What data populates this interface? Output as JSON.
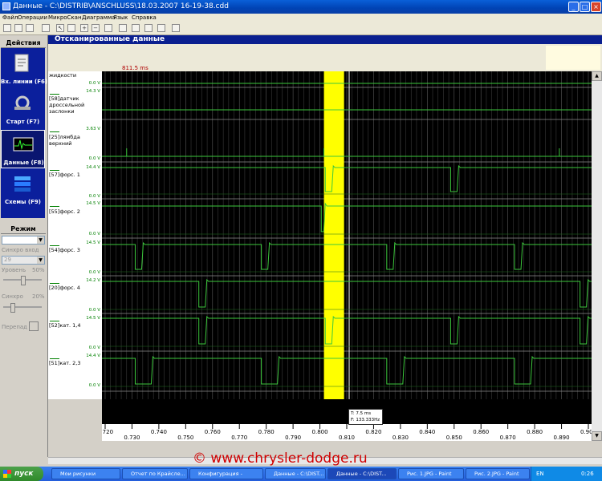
{
  "window": {
    "title": "Данные - C:\\DISTRIB\\ANSCHLUSS\\18.03.2007 16-19-38.cdd"
  },
  "menu": [
    "Файл",
    "Операции",
    "МикроСкан",
    "Диаграмма",
    "Язык",
    "Справка"
  ],
  "left_panel": {
    "actions_title": "Действия",
    "actions": [
      {
        "label": "Вх. линии (F6)",
        "icon": "input-lines-icon"
      },
      {
        "label": "Старт (F7)",
        "icon": "start-probe-icon"
      },
      {
        "label": "Данные (F8)",
        "icon": "waveform-data-icon"
      },
      {
        "label": "Схемы (F9)",
        "icon": "diagrams-icon"
      }
    ],
    "mode_title": "Режим",
    "sync_input_label": "Синхро вход",
    "sync_input_value": "29",
    "level_label": "Уровень",
    "level_value": "50%",
    "level_fraction": 0.5,
    "sync_label": "Синхро",
    "sync_value": "20%",
    "sync_fraction": 0.2,
    "retrigger_label": "Перепад"
  },
  "main": {
    "header": "Отсканированные данные",
    "cursor_time": "811.5 ms",
    "tooltip": {
      "t": "T: 7.5 ms",
      "f": "F: 133.333Hz"
    }
  },
  "channels": [
    {
      "name": "жидкости",
      "top": "",
      "bottom": "0.0 V"
    },
    {
      "name": "[58]датчик\nдроссельной\nзаслонки",
      "top": "14.3 V",
      "bottom": ""
    },
    {
      "name": "[25]лямбда верхний",
      "top": "3.63 V",
      "bottom": "0.0 V"
    },
    {
      "name": "[57]форс. 1",
      "top": "14.4 V",
      "bottom": "0.0 V"
    },
    {
      "name": "[55]форс. 2",
      "top": "14.5 V",
      "bottom": "0.0 V"
    },
    {
      "name": "[54]форс. 3",
      "top": "14.5 V",
      "bottom": "0.0 V"
    },
    {
      "name": "[20]форс. 4",
      "top": "14.2 V",
      "bottom": "0.0 V"
    },
    {
      "name": "[52]кат. 1,4",
      "top": "14.5 V",
      "bottom": "0.0 V"
    },
    {
      "name": "[51]кат. 2,3",
      "top": "14.4 V",
      "bottom": "0.0 V"
    }
  ],
  "chart_data": {
    "type": "line",
    "x_ticks": [
      "0.720",
      "0.730",
      "0.740",
      "0.750",
      "0.760",
      "0.770",
      "0.780",
      "0.790",
      "0.800",
      "0.810",
      "0.820",
      "0.830",
      "0.840",
      "0.850",
      "0.860",
      "0.870",
      "0.880",
      "0.890",
      "0.900"
    ],
    "xlim": [
      0.72,
      0.9
    ],
    "highlight_range": [
      0.8015,
      0.809
    ],
    "cursor_x": 0.8115,
    "injector_pulses": {
      "[57]форс. 1": [
        0.802,
        0.8487
      ],
      "[55]форс. 2": [
        0.8005
      ],
      "[54]форс. 3": [
        0.7312,
        0.7782,
        0.8249,
        0.8725
      ],
      "[20]форс. 4": [
        0.7549,
        0.8969
      ],
      "[52]кат. 1,4": [
        0.7549,
        0.802,
        0.8487,
        0.8969
      ],
      "[51]кат. 2,3": [
        0.7312,
        0.7782,
        0.8249,
        0.8725
      ]
    }
  },
  "taskbar": {
    "start": "пуск",
    "tasks": [
      "Мои рисунки",
      "Отчет по Крайсле...",
      "Конфигурация -",
      "Данные - C:\\DIST...",
      "Данные - C:\\DIST...",
      "Рис. 1.JPG - Paint",
      "Рис. 2.JPG - Paint"
    ],
    "lang": "EN",
    "time": "0:26"
  },
  "watermark": "© www.chrysler-dodge.ru"
}
